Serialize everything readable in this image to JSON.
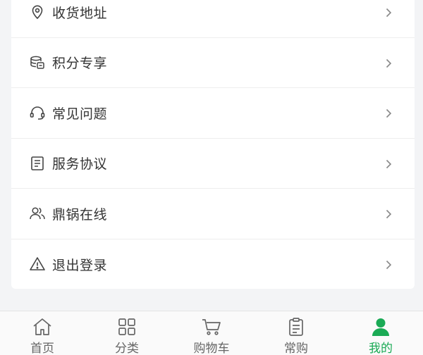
{
  "menu": {
    "items": [
      {
        "label": "收货地址",
        "icon": "location-pin-icon"
      },
      {
        "label": "积分专享",
        "icon": "coin-stack-icon"
      },
      {
        "label": "常见问题",
        "icon": "headset-icon"
      },
      {
        "label": "服务协议",
        "icon": "document-icon"
      },
      {
        "label": "鼎锅在线",
        "icon": "users-icon"
      },
      {
        "label": "退出登录",
        "icon": "warning-icon"
      }
    ]
  },
  "tabbar": {
    "active_color": "#1aaa55",
    "inactive_color": "#666666",
    "tabs": [
      {
        "label": "首页",
        "icon": "home-icon",
        "active": false
      },
      {
        "label": "分类",
        "icon": "grid-icon",
        "active": false
      },
      {
        "label": "购物车",
        "icon": "cart-icon",
        "active": false
      },
      {
        "label": "常购",
        "icon": "clipboard-icon",
        "active": false
      },
      {
        "label": "我的",
        "icon": "user-icon",
        "active": true
      }
    ]
  }
}
